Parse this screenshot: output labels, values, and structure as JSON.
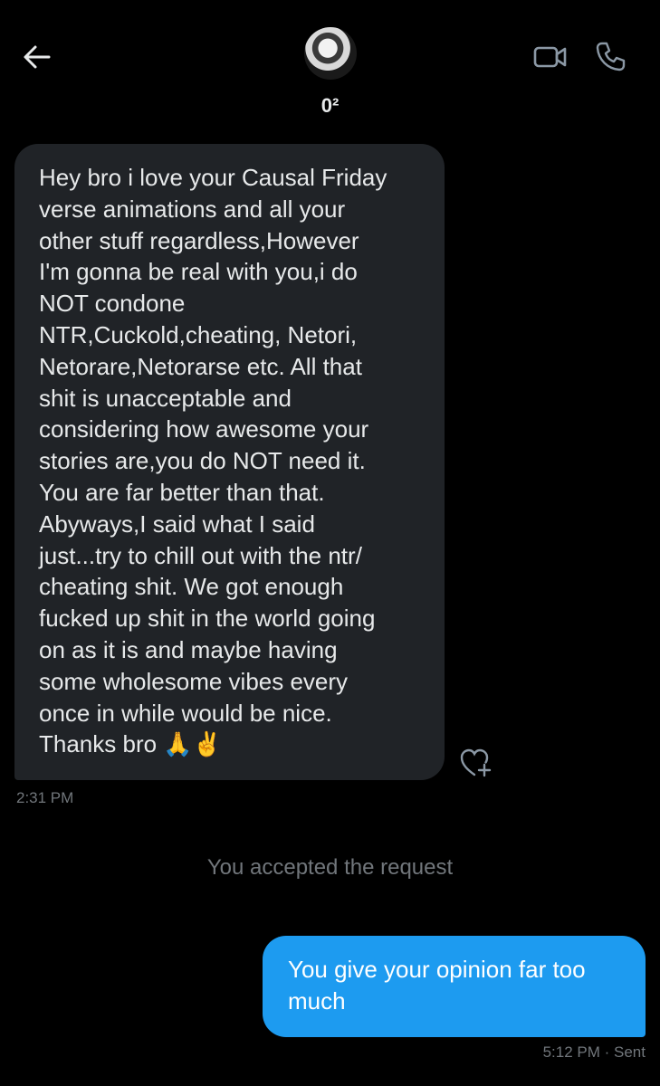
{
  "header": {
    "contact_name": "0²",
    "icons": {
      "back": "arrow-left-icon",
      "video": "video-camera-icon",
      "call": "phone-icon"
    }
  },
  "messages": {
    "incoming": {
      "text": "Hey bro i love your Causal Friday\nverse animations and all your\nother stuff regardless,However\nI'm gonna be real with you,i do\nNOT condone\nNTR,Cuckold,cheating, Netori,\nNetorare,Netorarse etc. All that\nshit is unacceptable and\nconsidering how awesome your\nstories are,you do NOT need it.\nYou are far better than that.\nAbyways,I said what I said\njust...try to chill out with the ntr/\ncheating shit. We got enough\nfucked up shit in the world going\non as it is and maybe having\nsome wholesome vibes every\nonce in while would be nice.\nThanks bro 🙏✌️",
      "time": "2:31 PM",
      "react_icon": "heart-add-icon"
    },
    "system": "You accepted the request",
    "outgoing": {
      "text": "You give your opinion far too\nmuch",
      "time": "5:12 PM",
      "status": "Sent"
    }
  },
  "colors": {
    "background": "#000000",
    "incoming_bubble": "#202327",
    "outgoing_bubble": "#1d9bf0",
    "secondary_text": "#71767b"
  }
}
